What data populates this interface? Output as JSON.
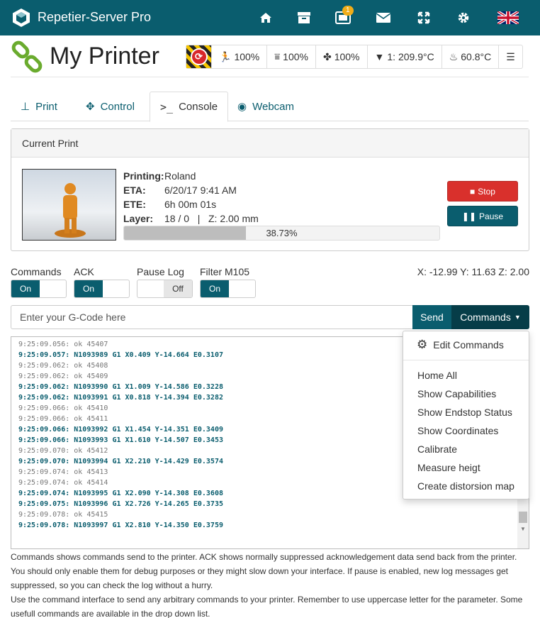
{
  "topbar": {
    "brand": "Repetier-Server Pro",
    "icons": [
      "home-icon",
      "archive-icon",
      "tablet-icon",
      "envelope-icon",
      "fullscreen-icon",
      "gear-icon",
      "uk-flag-icon"
    ],
    "badge_count": "1",
    "colors": {
      "bar": "#0a5d6e",
      "badge": "#f0ad18"
    }
  },
  "printer": {
    "title": "My Printer",
    "speed": "100%",
    "flow": "100%",
    "fan": "100%",
    "extruder": "1: 209.9°C",
    "bed": "60.8°C"
  },
  "tabs": [
    {
      "label": "Print",
      "icon": "print-icon"
    },
    {
      "label": "Control",
      "icon": "move-icon"
    },
    {
      "label": "Console",
      "icon": "terminal-icon",
      "active": true
    },
    {
      "label": "Webcam",
      "icon": "webcam-icon"
    }
  ],
  "current_print": {
    "heading": "Current Print",
    "printing_label": "Printing:",
    "printing_value": "Roland",
    "eta_label": "ETA:",
    "eta_value": "6/20/17 9:41 AM",
    "ete_label": "ETE:",
    "ete_value": "6h 00m 01s",
    "layer_label": "Layer:",
    "layer_value": "18 / 0   |   Z: 2.00 mm",
    "progress_text": "38.73%",
    "progress_fraction": 0.3873,
    "stop_label": "Stop",
    "pause_label": "Pause",
    "colors": {
      "stop": "#d9302c",
      "pause": "#0a5d6e"
    }
  },
  "toggles": [
    {
      "label": "Commands",
      "state": "On"
    },
    {
      "label": "ACK",
      "state": "On"
    },
    {
      "label": "Pause Log",
      "state": "Off"
    },
    {
      "label": "Filter M105",
      "state": "On"
    }
  ],
  "coords": "X: -12.99 Y: 11.63 Z: 2.00",
  "gcode": {
    "placeholder": "Enter your G-Code here",
    "send_label": "Send",
    "commands_label": "Commands"
  },
  "console_lines": [
    {
      "text": "9:25:09.056: ok 45407",
      "cmd": false
    },
    {
      "text": "9:25:09.057: N1093989 G1 X0.409 Y-14.664 E0.3107",
      "cmd": true
    },
    {
      "text": "9:25:09.062: ok 45408",
      "cmd": false
    },
    {
      "text": "9:25:09.062: ok 45409",
      "cmd": false
    },
    {
      "text": "9:25:09.062: N1093990 G1 X1.009 Y-14.586 E0.3228",
      "cmd": true
    },
    {
      "text": "9:25:09.062: N1093991 G1 X0.818 Y-14.394 E0.3282",
      "cmd": true
    },
    {
      "text": "9:25:09.066: ok 45410",
      "cmd": false
    },
    {
      "text": "9:25:09.066: ok 45411",
      "cmd": false
    },
    {
      "text": "9:25:09.066: N1093992 G1 X1.454 Y-14.351 E0.3409",
      "cmd": true
    },
    {
      "text": "9:25:09.066: N1093993 G1 X1.610 Y-14.507 E0.3453",
      "cmd": true
    },
    {
      "text": "9:25:09.070: ok 45412",
      "cmd": false
    },
    {
      "text": "9:25:09.070: N1093994 G1 X2.210 Y-14.429 E0.3574",
      "cmd": true
    },
    {
      "text": "9:25:09.074: ok 45413",
      "cmd": false
    },
    {
      "text": "9:25:09.074: ok 45414",
      "cmd": false
    },
    {
      "text": "9:25:09.074: N1093995 G1 X2.090 Y-14.308 E0.3608",
      "cmd": true
    },
    {
      "text": "9:25:09.075: N1093996 G1 X2.726 Y-14.265 E0.3735",
      "cmd": true
    },
    {
      "text": "9:25:09.078: ok 45415",
      "cmd": false
    },
    {
      "text": "9:25:09.078: N1093997 G1 X2.810 Y-14.350 E0.3759",
      "cmd": true
    }
  ],
  "dropdown": {
    "edit_label": "Edit Commands",
    "items": [
      "Home All",
      "Show Capabilities",
      "Show Endstop Status",
      "Show Coordinates",
      "Calibrate",
      "Measure heigt",
      "Create distorsion map"
    ]
  },
  "help": {
    "p1": "Commands shows commands send to the printer. ACK shows normally suppressed acknowledgement data send back from the printer. You should only enable them for debug purposes or they might slow down your interface. If pause is enabled, new log messages get suppressed, so you can check the log without a hurry.",
    "p2": "Use the command interface to send any arbitrary commands to your printer. Remember to use uppercase letter for the parameter. Some usefull commands are available in the drop down list."
  }
}
